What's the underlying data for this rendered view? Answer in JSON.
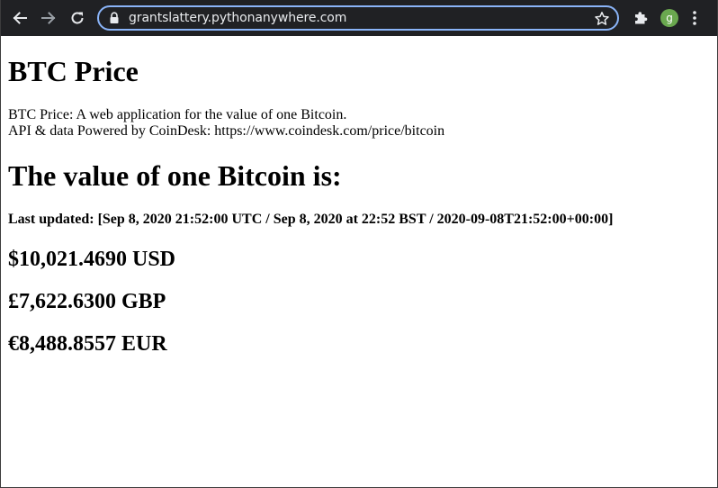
{
  "browser": {
    "url": "grantslattery.pythonanywhere.com",
    "avatar_letter": "g",
    "icons": {
      "back": "arrow-left-icon",
      "forward": "arrow-right-icon",
      "reload": "reload-icon",
      "lock": "lock-icon",
      "bookmark": "star-icon",
      "extensions": "puzzle-icon",
      "menu": "kebab-menu-icon"
    },
    "colors": {
      "toolbar_bg": "#202124",
      "omnibox_border": "#8ab4f8",
      "avatar_bg": "#6aa84f"
    }
  },
  "page": {
    "title": "BTC Price",
    "description_line1": "BTC Price: A web application for the value of one Bitcoin.",
    "description_line2": "API & data Powered by CoinDesk: https://www.coindesk.com/price/bitcoin",
    "value_heading": "The value of one Bitcoin is:",
    "last_updated": "Last updated: [Sep 8, 2020 21:52:00 UTC / Sep 8, 2020 at 22:52 BST / 2020-09-08T21:52:00+00:00]",
    "prices": {
      "usd": "$10,021.4690 USD",
      "gbp": "£7,622.6300 GBP",
      "eur": "€8,488.8557 EUR"
    }
  }
}
